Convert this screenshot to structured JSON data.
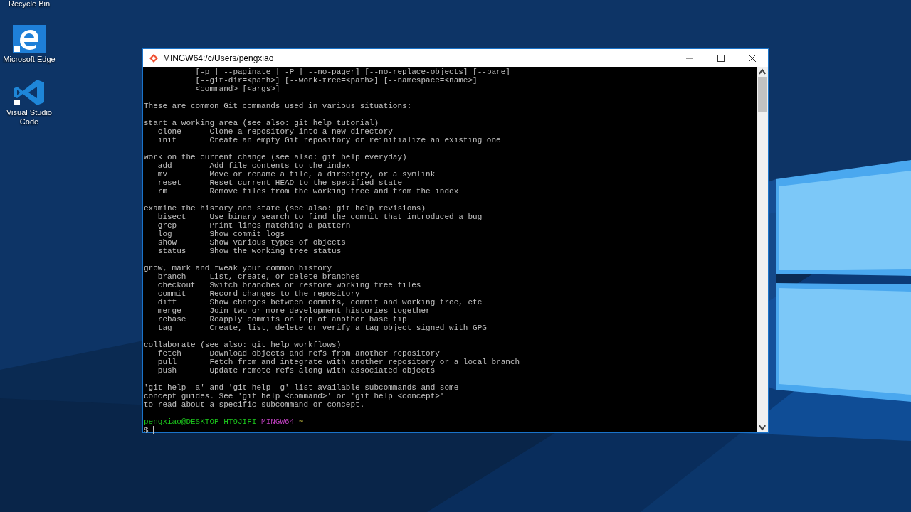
{
  "desktop_icons": [
    {
      "label": "Recycle Bin",
      "kind": "recycle"
    },
    {
      "label": "Microsoft Edge",
      "kind": "edge"
    },
    {
      "label": "Visual Studio Code",
      "kind": "vscode"
    }
  ],
  "window": {
    "title": "MINGW64:/c/Users/pengxiao"
  },
  "terminal": {
    "blocks": [
      {
        "lines": [
          {
            "kind": "continuation",
            "text": "[-p | --paginate | -P | --no-pager] [--no-replace-objects] [--bare]"
          },
          {
            "kind": "continuation",
            "text": "[--git-dir=<path>] [--work-tree=<path>] [--namespace=<name>]"
          },
          {
            "kind": "continuation",
            "text": "<command> [<args>]"
          }
        ]
      },
      {
        "lines": [
          {
            "kind": "text",
            "text": "These are common Git commands used in various situations:"
          }
        ]
      },
      {
        "lines": [
          {
            "kind": "text",
            "text": "start a working area (see also: git help tutorial)"
          },
          {
            "kind": "command",
            "name": "clone",
            "description": "Clone a repository into a new directory"
          },
          {
            "kind": "command",
            "name": "init",
            "description": "Create an empty Git repository or reinitialize an existing one"
          }
        ]
      },
      {
        "lines": [
          {
            "kind": "text",
            "text": "work on the current change (see also: git help everyday)"
          },
          {
            "kind": "command",
            "name": "add",
            "description": "Add file contents to the index"
          },
          {
            "kind": "command",
            "name": "mv",
            "description": "Move or rename a file, a directory, or a symlink"
          },
          {
            "kind": "command",
            "name": "reset",
            "description": "Reset current HEAD to the specified state"
          },
          {
            "kind": "command",
            "name": "rm",
            "description": "Remove files from the working tree and from the index"
          }
        ]
      },
      {
        "lines": [
          {
            "kind": "text",
            "text": "examine the history and state (see also: git help revisions)"
          },
          {
            "kind": "command",
            "name": "bisect",
            "description": "Use binary search to find the commit that introduced a bug"
          },
          {
            "kind": "command",
            "name": "grep",
            "description": "Print lines matching a pattern"
          },
          {
            "kind": "command",
            "name": "log",
            "description": "Show commit logs"
          },
          {
            "kind": "command",
            "name": "show",
            "description": "Show various types of objects"
          },
          {
            "kind": "command",
            "name": "status",
            "description": "Show the working tree status"
          }
        ]
      },
      {
        "lines": [
          {
            "kind": "text",
            "text": "grow, mark and tweak your common history"
          },
          {
            "kind": "command",
            "name": "branch",
            "description": "List, create, or delete branches"
          },
          {
            "kind": "command",
            "name": "checkout",
            "description": "Switch branches or restore working tree files"
          },
          {
            "kind": "command",
            "name": "commit",
            "description": "Record changes to the repository"
          },
          {
            "kind": "command",
            "name": "diff",
            "description": "Show changes between commits, commit and working tree, etc"
          },
          {
            "kind": "command",
            "name": "merge",
            "description": "Join two or more development histories together"
          },
          {
            "kind": "command",
            "name": "rebase",
            "description": "Reapply commits on top of another base tip"
          },
          {
            "kind": "command",
            "name": "tag",
            "description": "Create, list, delete or verify a tag object signed with GPG"
          }
        ]
      },
      {
        "lines": [
          {
            "kind": "text",
            "text": "collaborate (see also: git help workflows)"
          },
          {
            "kind": "command",
            "name": "fetch",
            "description": "Download objects and refs from another repository"
          },
          {
            "kind": "command",
            "name": "pull",
            "description": "Fetch from and integrate with another repository or a local branch"
          },
          {
            "kind": "command",
            "name": "push",
            "description": "Update remote refs along with associated objects"
          }
        ]
      },
      {
        "lines": [
          {
            "kind": "text",
            "text": "'git help -a' and 'git help -g' list available subcommands and some"
          },
          {
            "kind": "text",
            "text": "concept guides. See 'git help <command>' or 'git help <concept>'"
          },
          {
            "kind": "text",
            "text": "to read about a specific subcommand or concept."
          }
        ]
      }
    ],
    "prompt": {
      "user_host": "pengxiao@DESKTOP-HT9JIFI",
      "system": "MINGW64",
      "path": "~",
      "symbol": "$"
    }
  }
}
